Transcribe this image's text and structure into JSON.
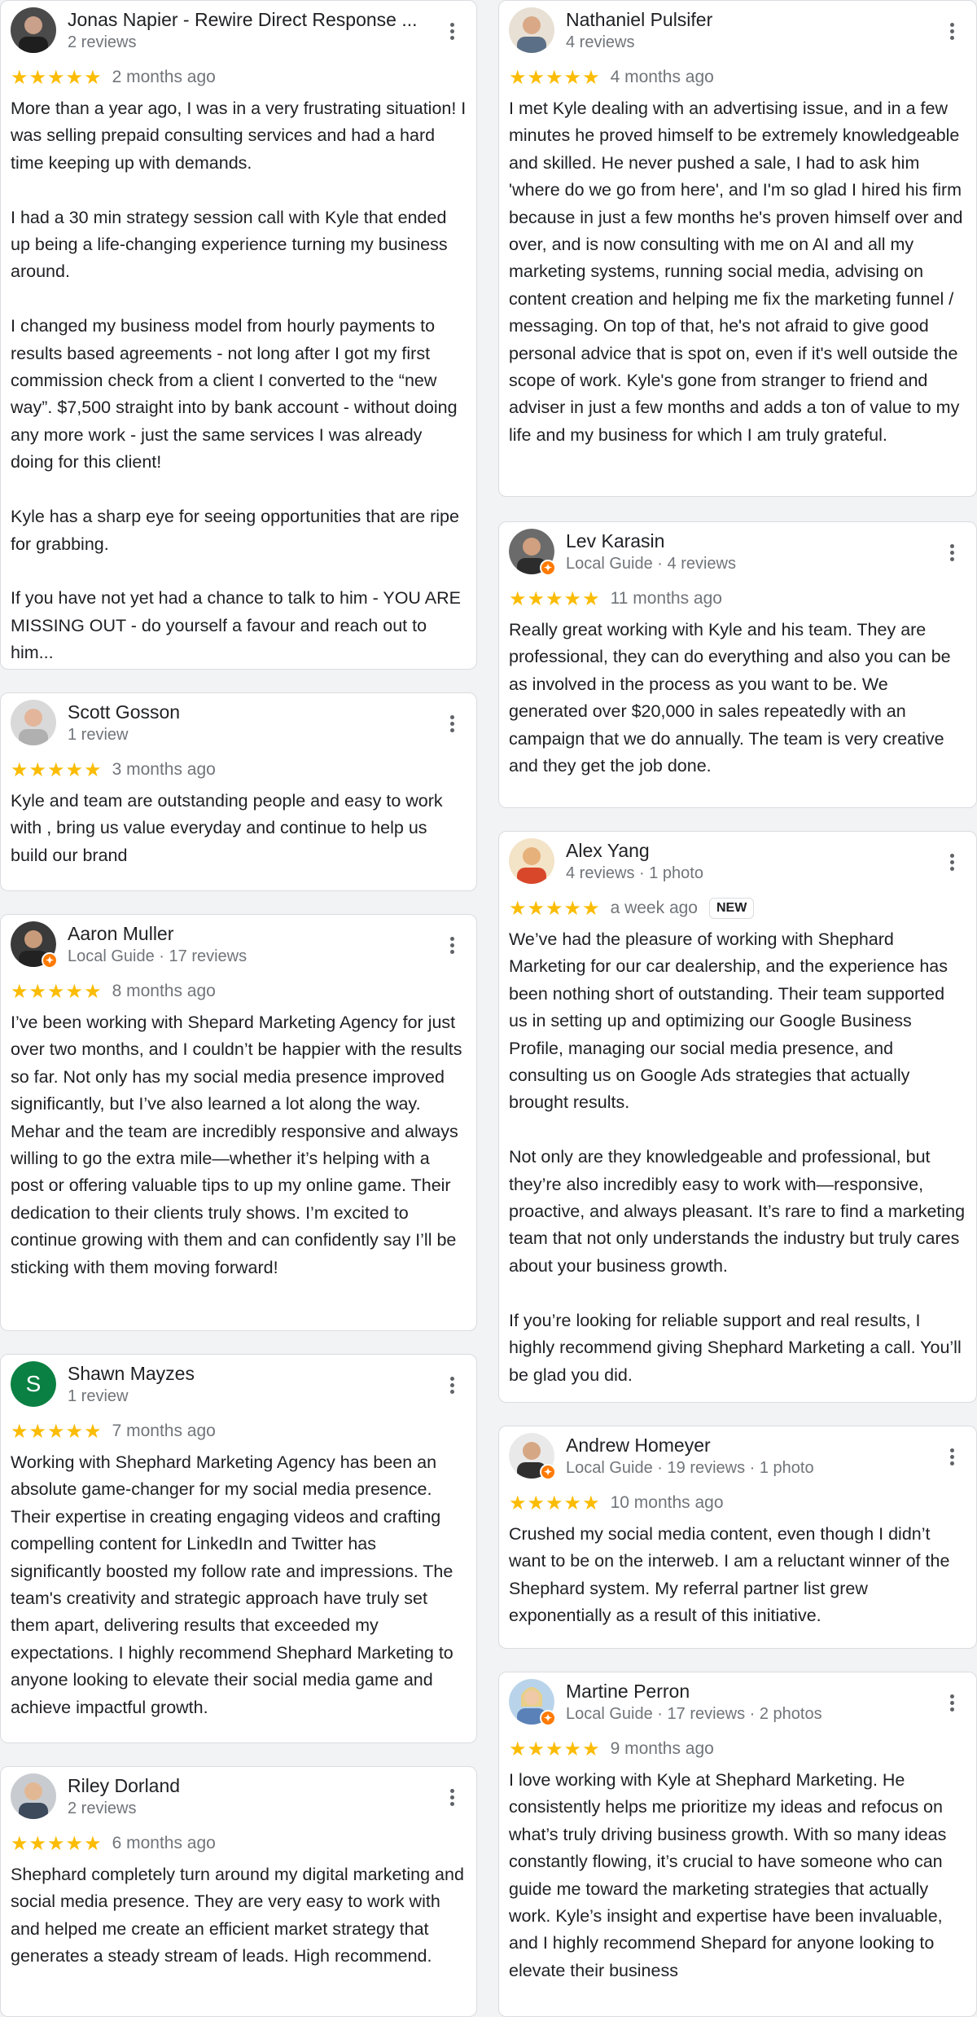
{
  "stars": "★★★★★",
  "colors": {
    "star": "#fbbc04",
    "guide_badge": "#ff7a00",
    "letter_avatar": "#0b8043"
  },
  "left": [
    {
      "name": "Jonas Napier - Rewire Direct Response ...",
      "meta": "2 reviews",
      "time": "2 months ago",
      "text": "More than a year ago, I was in a very frustrating situation! I was selling prepaid consulting services and had a hard time keeping up with demands.\n\nI had a 30 min strategy session call with Kyle that ended up being a life-changing experience turning my business around.\n\nI changed my business model from hourly payments to results based agreements - not long after I got my first commission check from a client I converted to the “new way”.  $7,500 straight into by bank account - without doing any more work - just the same services I was already doing for this client!\n\nKyle has a sharp eye for seeing opportunities that are ripe for grabbing.\n\nIf you have not yet had a chance to talk to him - YOU ARE MISSING OUT - do yourself a favour and reach out to him..."
    },
    {
      "name": "Scott Gosson",
      "meta": "1 review",
      "time": "3 months ago",
      "text": "Kyle and team are outstanding people and easy to work with , bring us value everyday and continue to help us build our brand"
    },
    {
      "name": "Aaron Muller",
      "meta": "Local Guide · 17 reviews",
      "time": "8 months ago",
      "text": "I’ve been working with Shepard Marketing Agency for just over two months, and I couldn’t be happier with the results so far. Not only has my social media presence improved significantly, but I’ve also learned a lot along the way. Mehar and the team are incredibly responsive and always willing to go the extra mile—whether it’s helping with a post or offering valuable tips to up my online game. Their dedication to their clients truly shows. I’m excited to continue growing with them and can confidently say I’ll be sticking with them moving forward!"
    },
    {
      "name": "Shawn Mayzes",
      "meta": "1 review",
      "avatar_letter": "S",
      "time": "7 months ago",
      "text": "Working with Shephard Marketing Agency has been an absolute game-changer for my social media presence. Their expertise in creating engaging videos and crafting compelling content for LinkedIn and Twitter has significantly boosted my follow rate and impressions. The team's creativity and strategic approach have truly set them apart, delivering results that exceeded my expectations. I highly recommend Shephard Marketing to anyone looking to elevate their social media game and achieve impactful growth."
    },
    {
      "name": "Riley Dorland",
      "meta": "2 reviews",
      "time": "6 months ago",
      "text": "Shephard completely turn around my digital marketing and social media presence. They are very easy to work with and helped me create an efficient market strategy that generates a steady stream of leads. High recommend."
    }
  ],
  "right": [
    {
      "name": "Nathaniel Pulsifer",
      "meta": "4 reviews",
      "time": "4 months ago",
      "text": "I met Kyle dealing with an advertising issue, and in a few minutes he proved himself to be extremely knowledgeable and skilled.  He never pushed a sale, I had to ask him 'where do we go from here', and I'm so glad I hired his firm because in just a few months he's proven himself over and over, and is now consulting with me on AI and all my marketing systems, running social media, advising on content creation and helping me fix the marketing funnel / messaging.  On top of that, he's not afraid to give good personal advice that is spot on, even if it's well outside the scope of work.  Kyle's gone from stranger to friend and adviser in just a few months and adds a ton of value to my life and my business for which I am truly grateful."
    },
    {
      "name": "Lev Karasin",
      "meta": "Local Guide · 4 reviews",
      "time": "11 months ago",
      "text": "Really great working with Kyle and his team. They are professional, they can do everything and also you can be as involved in the process as you want to be. We generated over $20,000 in sales repeatedly with an campaign that we do annually. The team is very creative and they get the job done."
    },
    {
      "name": "Alex Yang",
      "meta": "4 reviews · 1 photo",
      "time": "a week ago",
      "badge": "NEW",
      "text": "We’ve had the pleasure of working with Shephard Marketing for our car dealership, and the experience has been nothing short of outstanding. Their team supported us in setting up and optimizing our Google Business Profile, managing our social media presence, and consulting us on Google Ads strategies that actually brought results.\n\nNot only are they knowledgeable and professional, but they’re also incredibly easy to work with—responsive, proactive, and always pleasant. It’s rare to find a marketing team that not only understands the industry but truly cares about your business growth.\n\nIf you’re looking for reliable support and real results, I highly recommend giving Shephard Marketing a call. You’ll be glad you did."
    },
    {
      "name": "Andrew Homeyer",
      "meta": "Local Guide · 19 reviews · 1 photo",
      "time": "10 months ago",
      "text": "Crushed my social media content, even though I didn’t want to be on the interweb. I am a reluctant winner of the Shephard system. My referral partner list grew exponentially as a result of this initiative."
    },
    {
      "name": "Martine Perron",
      "meta": "Local Guide · 17 reviews · 2 photos",
      "time": "9 months ago",
      "text": "I love working with Kyle at Shephard Marketing. He consistently helps me prioritize my ideas and refocus on what’s truly driving business growth. With so many ideas constantly flowing, it’s crucial to have someone who can guide me toward the marketing strategies that actually work. Kyle’s insight and expertise have been invaluable, and I highly recommend Shepard for anyone looking to elevate their business"
    }
  ]
}
